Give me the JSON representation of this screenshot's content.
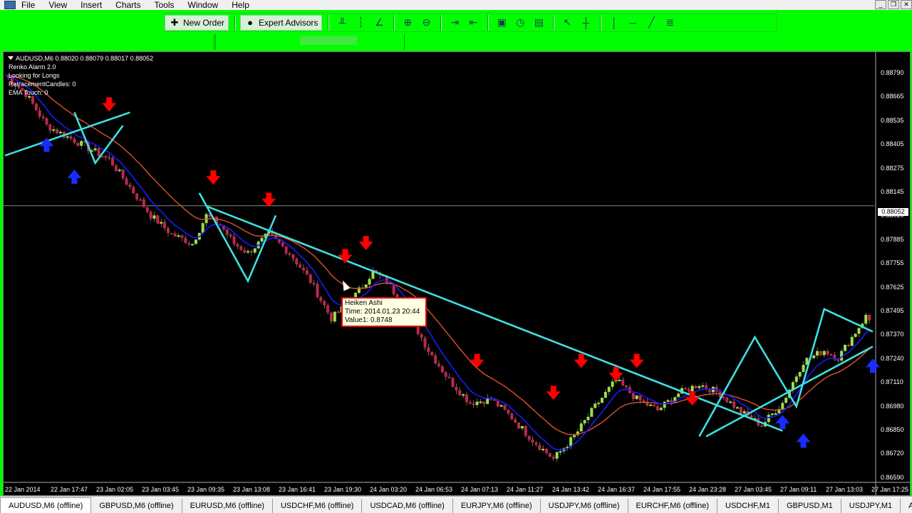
{
  "menu": {
    "items": [
      "File",
      "View",
      "Insert",
      "Charts",
      "Tools",
      "Window",
      "Help"
    ]
  },
  "toolbar": {
    "new_order_label": "New Order",
    "expert_advisors_label": "Expert Advisors",
    "icons": [
      "bar-chart-icon",
      "candlestick-icon",
      "line-chart-icon",
      "zoom-in-icon",
      "zoom-out-icon",
      "chart-shift-icon",
      "autoscroll-icon",
      "indicators-icon",
      "periods-icon",
      "templates-icon",
      "cursor-icon",
      "crosshair-icon",
      "vertical-line-icon",
      "horizontal-line-icon",
      "trendline-icon",
      "fibonacci-icon"
    ]
  },
  "chart": {
    "symbol_header": "AUDUSD,M6  0.88020 0.88079 0.88017 0.88052",
    "overlay_lines": [
      "Renko Alarm 2.0",
      "Looking for Longs",
      "RetracementCandles: 0",
      "EMA Touch: 0"
    ],
    "current_price": "0.88052",
    "price_labels": [
      "0.88790",
      "0.88665",
      "0.88535",
      "0.88405",
      "0.88275",
      "0.88145",
      "0.88020",
      "0.87885",
      "0.87755",
      "0.87625",
      "0.87495",
      "0.87370",
      "0.87240",
      "0.87110",
      "0.86980",
      "0.86850",
      "0.86720",
      "0.86590"
    ],
    "time_labels": [
      "22 Jan 2014",
      "22 Jan 17:47",
      "23 Jan 02:05",
      "23 Jan 03:45",
      "23 Jan 09:35",
      "23 Jan 13:08",
      "23 Jan 16:41",
      "23 Jan 19:30",
      "24 Jan 03:20",
      "24 Jan 06:53",
      "24 Jan 07:13",
      "24 Jan 11:27",
      "24 Jan 13:42",
      "24 Jan 16:37",
      "24 Jan 17:55",
      "24 Jan 23:28",
      "27 Jan 03:45",
      "27 Jan 09:11",
      "27 Jan 13:03",
      "27 Jan 17:25"
    ],
    "tooltip": {
      "title": "Heiken Ashi",
      "time": "Time: 2014.01.23 20:44",
      "value": "Value1: 0.8748"
    },
    "colors": {
      "bull": "#9be04a",
      "bear": "#c0264a",
      "ema_fast": "#1a1aff",
      "ema_slow": "#e0502a",
      "trend": "#40e0e0",
      "sell_arrow": "#ff0000",
      "buy_arrow": "#1a2cff"
    }
  },
  "chart_data": {
    "type": "candlestick",
    "symbol": "AUDUSD",
    "timeframe": "M6",
    "ylim": [
      0.8659,
      0.8885
    ],
    "close_path": [
      [
        0,
        0.8875
      ],
      [
        6,
        0.8865
      ],
      [
        12,
        0.8848
      ],
      [
        18,
        0.8842
      ],
      [
        24,
        0.8836
      ],
      [
        30,
        0.883
      ],
      [
        36,
        0.8815
      ],
      [
        42,
        0.88
      ],
      [
        48,
        0.879
      ],
      [
        54,
        0.8785
      ],
      [
        58,
        0.88
      ],
      [
        62,
        0.8795
      ],
      [
        66,
        0.8785
      ],
      [
        70,
        0.878
      ],
      [
        76,
        0.879
      ],
      [
        82,
        0.878
      ],
      [
        88,
        0.8765
      ],
      [
        94,
        0.8745
      ],
      [
        100,
        0.8755
      ],
      [
        106,
        0.877
      ],
      [
        110,
        0.8765
      ],
      [
        116,
        0.8748
      ],
      [
        122,
        0.8728
      ],
      [
        128,
        0.8712
      ],
      [
        134,
        0.87
      ],
      [
        140,
        0.8702
      ],
      [
        146,
        0.8692
      ],
      [
        152,
        0.868
      ],
      [
        158,
        0.867
      ],
      [
        164,
        0.8682
      ],
      [
        170,
        0.8698
      ],
      [
        176,
        0.8712
      ],
      [
        182,
        0.8702
      ],
      [
        188,
        0.8696
      ],
      [
        194,
        0.8705
      ],
      [
        200,
        0.871
      ],
      [
        206,
        0.8705
      ],
      [
        212,
        0.8695
      ],
      [
        218,
        0.8688
      ],
      [
        224,
        0.87
      ],
      [
        230,
        0.8722
      ],
      [
        236,
        0.8728
      ],
      [
        240,
        0.8724
      ],
      [
        244,
        0.8735
      ],
      [
        248,
        0.8746
      ],
      [
        250,
        0.8742
      ]
    ]
  }
}
